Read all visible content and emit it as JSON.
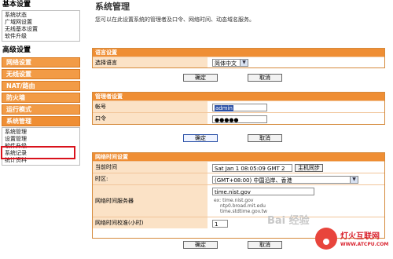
{
  "sidebar": {
    "basic_heading": "基本设置",
    "basic_items": [
      "系统状态",
      "广域网设置",
      "无线基本设置",
      "软件升级"
    ],
    "advanced_heading": "高级设置",
    "bars": [
      "网络设置",
      "无线设置",
      "NAT/路由",
      "防火墙",
      "运行模式",
      "系统管理"
    ],
    "mgmt_items": [
      "系统管理",
      "设置管理",
      "软件升级",
      "系统记录",
      "统计资料"
    ]
  },
  "page": {
    "title": "系统管理",
    "description": "您可以在此设置系统的管理者及口令、网络时间、动态域名服务。"
  },
  "language": {
    "section_title": "语言设置",
    "label": "选择语言",
    "value": "简体中文",
    "apply": "确定",
    "cancel": "取消"
  },
  "admin": {
    "section_title": "管理者设置",
    "account_label": "帐号",
    "account_value": "admin",
    "password_label": "口令",
    "password_value": "●●●●●",
    "apply": "确定",
    "cancel": "取消"
  },
  "ntp": {
    "section_title": "网络时间设置",
    "current_time_label": "当前时间",
    "current_time_value": "Sat Jan  1 08:05:09 GMT 2",
    "sync_button": "主机同步",
    "timezone_label": "时区:",
    "timezone_value": "(GMT+08:00) 中国沿岸、香港",
    "server_label": "网络时间服务器",
    "server_value": "time.nist.gov",
    "server_hints": [
      "ex: time.nist.gov",
      "ntp0.broad.mit.edu",
      "time.stdtime.gov.tw"
    ],
    "sync_interval_label": "网络时间校准(小时)",
    "sync_interval_value": "1",
    "apply": "确定",
    "cancel": "取消"
  },
  "watermark": {
    "title": "灯火互联网",
    "url": "WWW.ATCPU.COM",
    "baidu": "Bai 经验"
  },
  "colors": {
    "accent": "#ef8e34",
    "label_bg": "#fbe2c6",
    "highlight": "#d9121c"
  }
}
